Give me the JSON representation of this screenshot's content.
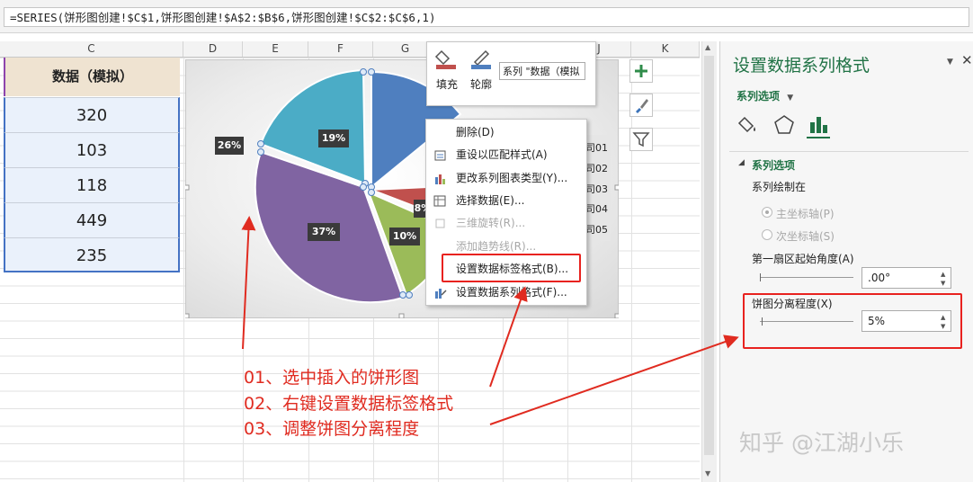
{
  "formula_bar": {
    "formula": "=SERIES(饼形图创建!$C$1,饼形图创建!$A$2:$B$6,饼形图创建!$C$2:$C$6,1)"
  },
  "columns": [
    "C",
    "D",
    "E",
    "F",
    "G",
    "H",
    "I",
    "J",
    "K"
  ],
  "table": {
    "header": "数据（模拟）",
    "values": [
      "320",
      "103",
      "118",
      "449",
      "235"
    ]
  },
  "chart": {
    "slice_labels": [
      "26%",
      "8%",
      "10%",
      "37%",
      "19%"
    ],
    "legend_fragments": [
      "司01",
      "司02",
      "司03",
      "司04",
      "司05"
    ],
    "colors": {
      "blue": "#4f7fbf",
      "red": "#c0504d",
      "green": "#9bbb59",
      "purple": "#8064a2",
      "teal": "#4bacc6"
    }
  },
  "mini_toolbar": {
    "fill_label": "填充",
    "outline_label": "轮廓",
    "series_select": "系列 \"数据（模拟"
  },
  "context_menu": {
    "items": [
      {
        "label": "删除(D)",
        "icon": "none",
        "enabled": true
      },
      {
        "label": "重设以匹配样式(A)",
        "icon": "reset-style-icon",
        "enabled": true
      },
      {
        "label": "更改系列图表类型(Y)...",
        "icon": "chart-type-icon",
        "enabled": true
      },
      {
        "label": "选择数据(E)...",
        "icon": "select-data-icon",
        "enabled": true
      },
      {
        "label": "三维旋转(R)...",
        "icon": "3d-rotate-icon",
        "enabled": false
      },
      {
        "label": "添加趋势线(R)...",
        "icon": "none",
        "enabled": false
      },
      {
        "label": "设置数据标签格式(B)...",
        "icon": "none",
        "enabled": true
      },
      {
        "label": "设置数据系列格式(F)...",
        "icon": "format-series-icon",
        "enabled": true
      }
    ]
  },
  "chart_side_buttons": [
    "plus-icon",
    "brush-icon",
    "filter-icon"
  ],
  "pane": {
    "title": "设置数据系列格式",
    "section_dropdown": "系列选项",
    "section_header": "系列选项",
    "plot_on": "系列绘制在",
    "radio_primary": "主坐标轴(P)",
    "radio_secondary": "次坐标轴(S)",
    "angle_label": "第一扇区起始角度(A)",
    "angle_value": ".00°",
    "explode_label": "饼图分离程度(X)",
    "explode_value": "5%"
  },
  "annotations": {
    "step1": "01、选中插入的饼形图",
    "step2": "02、右键设置数据标签格式",
    "step3": "03、调整饼图分离程度"
  },
  "watermark": "知乎 @江湖小乐",
  "accent_color": "#217346",
  "annotation_color": "#e02b20"
}
